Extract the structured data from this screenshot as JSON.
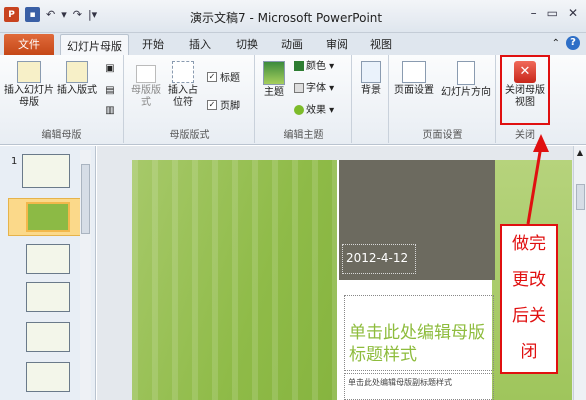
{
  "window": {
    "title": "演示文稿7 - Microsoft PowerPoint"
  },
  "qat": {
    "app_icon": "P"
  },
  "tabs": {
    "file": "文件",
    "items": [
      "幻灯片母版",
      "开始",
      "插入",
      "切换",
      "动画",
      "审阅",
      "视图"
    ]
  },
  "ribbon": {
    "edit_master": {
      "label": "编辑母版",
      "insert_slide_master": "插入幻灯片母版",
      "insert_layout": "插入版式"
    },
    "master_layout": {
      "label": "母版版式",
      "master_layout_btn": "母版版式",
      "insert_placeholder": "插入占位符",
      "title_check": "标题",
      "footer_check": "页脚"
    },
    "edit_theme": {
      "label": "编辑主题",
      "themes": "主题",
      "colors": "颜色",
      "fonts": "字体",
      "effects": "效果"
    },
    "background": {
      "label": "背景",
      "background_btn": "背景"
    },
    "page_setup": {
      "label": "页面设置",
      "page_setup_btn": "页面设置",
      "orientation": "幻灯片方向"
    },
    "close": {
      "label": "关闭",
      "close_btn": "关闭母版视图"
    }
  },
  "thumbnails": {
    "first_number": "1"
  },
  "slide": {
    "date": "2012-4-12",
    "title_placeholder": "单击此处编辑母版标题样式",
    "subtitle_placeholder": "单击此处编辑母版副标题样式"
  },
  "annotation": {
    "lines": [
      "做完",
      "更改",
      "后关",
      "闭"
    ]
  },
  "colors": {
    "accent_green": "#8ebc3d",
    "annotation_red": "#e01010",
    "file_tab": "#c54818"
  }
}
